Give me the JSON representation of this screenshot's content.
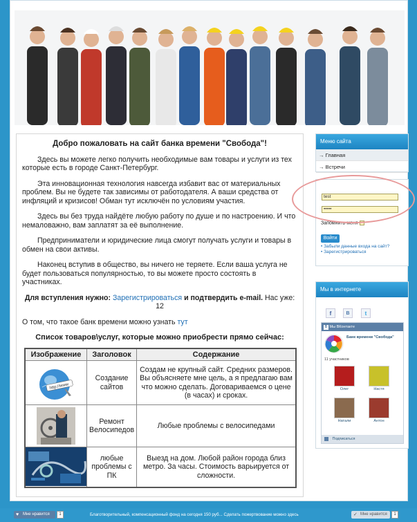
{
  "main": {
    "title": "Добро пожаловать на сайт банка времени \"Свобода\"!",
    "p1": "Здесь вы можете легко получить необходимые вам товары и услуги из тех которые есть в городе Санкт-Петербург.",
    "p2": "Эта инновационная технология навсегда избавит вас от материальных проблем. Вы не будете так зависимы от работодателя. А ваши средства от инфляций и кризисов! Обман тут исключён по условиям участия.",
    "p3": "Здесь вы без труда найдёте любую работу по душе и по настроению. И что немаловажно, вам заплатят за её выполнение.",
    "p4": "Предприниматели и юридические лица смогут получать услуги и товары в обмен на свои активы.",
    "p5": "Наконец вступив в общество, вы ничего не теряете. Если ваша услуга не будет пользоваться популярностью, то вы можете просто состоять в участниках.",
    "join_prefix": "Для вступления нужно:",
    "join_link": "Зарегистрироваться",
    "join_suffix": "и подтвердить e-mail.",
    "count_text": "Нас уже: 12",
    "about_prefix": "О том, что такое банк времени можно узнать",
    "about_link": "тут",
    "list_title": "Список товаров\\услуг, которые можно приобрести прямо сейчас:",
    "table": {
      "headers": [
        "Изображение",
        "Заголовок",
        "Содержание"
      ],
      "rows": [
        {
          "title": "Создание сайтов",
          "content": "Создам не крупный сайт. Средних размеров. Вы объясняете мне цель, а я предлагаю вам что можно сделать. Договариваемся о цене (в часах) и сроках.",
          "image": "web-icon"
        },
        {
          "title": "Ремонт Велосипедов",
          "content": "Любые проблемы с велосипедами",
          "image": "bicycle-repair-photo"
        },
        {
          "title": "любые проблемы с ПК",
          "content": "Выезд на дом. Любой район города близ метро. За часы. Стоимость варьируется от сложности.",
          "image": "pc-repair-photo"
        }
      ]
    }
  },
  "menu": {
    "title": "Меню сайта",
    "items": [
      {
        "label": "Главная",
        "active": true
      },
      {
        "label": "Встречи",
        "active": false
      }
    ]
  },
  "login": {
    "username": "test",
    "password": "•••••",
    "remember_label": "Запомнить меня",
    "submit_label": "Войти",
    "links": [
      "Забыли данные входа на сайт?",
      "Зарегистрироваться"
    ]
  },
  "internet": {
    "title": "Мы в интернете",
    "vk_header": "Мы ВКонтакте",
    "group_name": "Банк времени \"Свобода\"",
    "members_count": "11 участников",
    "members": [
      {
        "name": "Олег",
        "color": "#b51d1d"
      },
      {
        "name": "Настя",
        "color": "#c8c12a"
      },
      {
        "name": "Натали",
        "color": "#8a6a4e"
      },
      {
        "name": "Антон",
        "color": "#9b3b2e"
      }
    ],
    "subscribe_label": "Подписаться"
  },
  "footer": {
    "like_left": "Мне нравится",
    "like_left_count": "1",
    "fund_text": "Благотворительный, компенсационный фонд на сегодня 150 руб... Сделать пожертвование можно здесь",
    "like_right": "Мне нравится",
    "like_right_count": "1"
  },
  "colors": {
    "accent": "#2c95c9",
    "link": "#1f6fb5",
    "highlight_circle": "#e89a9a"
  }
}
